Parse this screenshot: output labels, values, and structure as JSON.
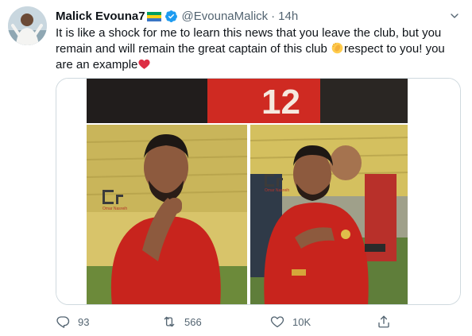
{
  "tweet": {
    "author": {
      "display_name": "Malick Evouna7",
      "handle": "@EvounaMalick",
      "separator": "·",
      "time": "14h",
      "avatar_icon": "profile-photo",
      "flag_icon": "gabon-flag-emoji",
      "verified_icon": "verified-badge-icon"
    },
    "text_before": "It is like a shock for me to learn this news that you leave the club, but you remain and will remain the great captain of this club ",
    "emoji_1": "clapping-hand-emoji",
    "text_middle": "respect to you! you are an example",
    "emoji_2": "red-heart-emoji",
    "media": {
      "description_icon": "football-player-collage-photo",
      "watermark": "Omar Nasreih"
    },
    "actions": {
      "reply_count": "93",
      "retweet_count": "566",
      "like_count": "10K"
    }
  },
  "colors": {
    "text_primary": "#0f1419",
    "text_secondary": "#536471",
    "verified_blue": "#1d9bf0",
    "heart_red": "#e0245e",
    "jersey_red": "#c8241d"
  }
}
